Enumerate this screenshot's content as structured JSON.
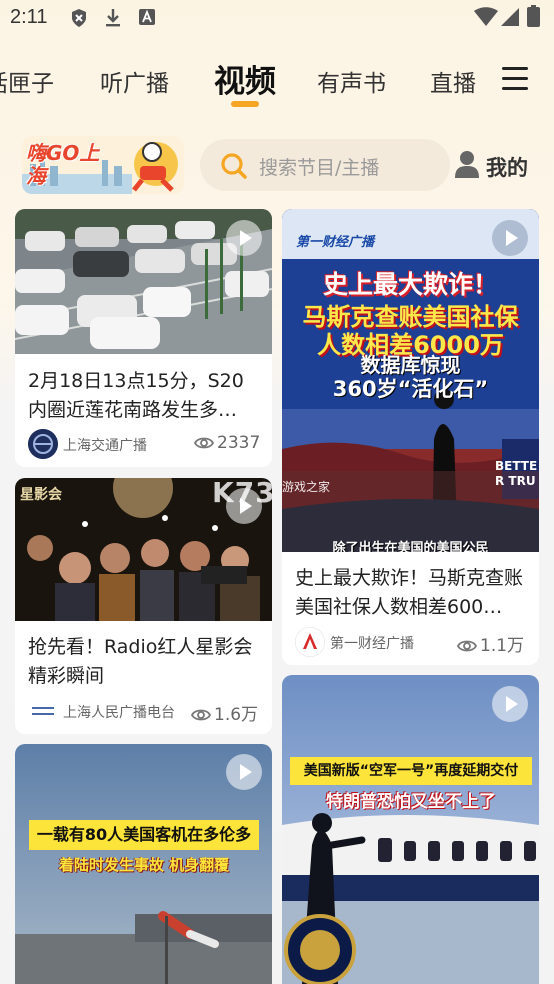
{
  "status_bar": {
    "time": "2:11"
  },
  "tabs": [
    {
      "label": "话匣子",
      "active": false
    },
    {
      "label": "听广播",
      "active": false
    },
    {
      "label": "视频",
      "active": true
    },
    {
      "label": "有声书",
      "active": false
    },
    {
      "label": "直播",
      "active": false
    }
  ],
  "header": {
    "logo_text": "嗨GO上海",
    "search_placeholder": "搜索节目/主播",
    "mine_label": "我的"
  },
  "accent_color": "#f5a623",
  "watermark": {
    "brand": "K73",
    "sub": "游戏之家"
  },
  "cards": [
    {
      "title": "2月18日13点15分，S20内圈近莲花南路发生多…",
      "source": "上海交通广播",
      "views": "2337"
    },
    {
      "title": "史上最大欺诈！马斯克查账美国社保人数相差600…",
      "source": "第一财经广播",
      "views": "1.1万",
      "thumb_brand": "第一财经广播",
      "thumb_headline_1": "史上最大欺诈！",
      "thumb_headline_2": "马斯克查账美国社保",
      "thumb_headline_3": "人数相差6000万",
      "thumb_headline_4": "数据库惊现",
      "thumb_headline_5": "360岁“活化石”",
      "thumb_caption": "除了出生在美国的美国公民",
      "thumb_sign": "BETTER TRU"
    },
    {
      "title": "抢先看！Radio红人星影会精彩瞬间",
      "source": "上海人民广播电台",
      "views": "1.6万",
      "thumb_sign": "星影会"
    },
    {
      "thumb_headline_1": "一载有80人美国客机在多伦多",
      "thumb_headline_2": "着陆时发生事故 机身翻覆"
    },
    {
      "thumb_headline_1": "美国新版“空军一号”再度延期交付",
      "thumb_headline_2": "特朗普恐怕又坐不上了"
    }
  ]
}
